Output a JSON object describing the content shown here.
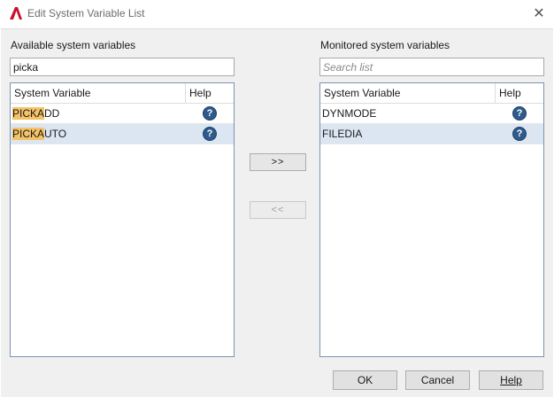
{
  "window": {
    "title": "Edit System Variable List"
  },
  "available": {
    "label": "Available system variables",
    "search_value": "picka",
    "columns": [
      "System Variable",
      "Help"
    ],
    "rows": [
      {
        "match": "PICKA",
        "rest": "DD"
      },
      {
        "match": "PICKA",
        "rest": "UTO"
      }
    ]
  },
  "monitored": {
    "label": "Monitored system variables",
    "search_placeholder": "Search list",
    "columns": [
      "System Variable",
      "Help"
    ],
    "rows": [
      {
        "name": "DYNMODE"
      },
      {
        "name": "FILEDIA"
      }
    ]
  },
  "transfer": {
    "add_label": ">>",
    "remove_label": "<<"
  },
  "buttons": {
    "ok": "OK",
    "cancel": "Cancel",
    "help": "Help"
  },
  "icons": {
    "app": "autocad-logo-icon",
    "close": "close-icon",
    "help": "help-question-icon"
  },
  "colors": {
    "highlight": "#f5c267",
    "selection": "#dce6f2",
    "help_icon": "#2e5a8c",
    "app_logo": "#c8102e"
  }
}
